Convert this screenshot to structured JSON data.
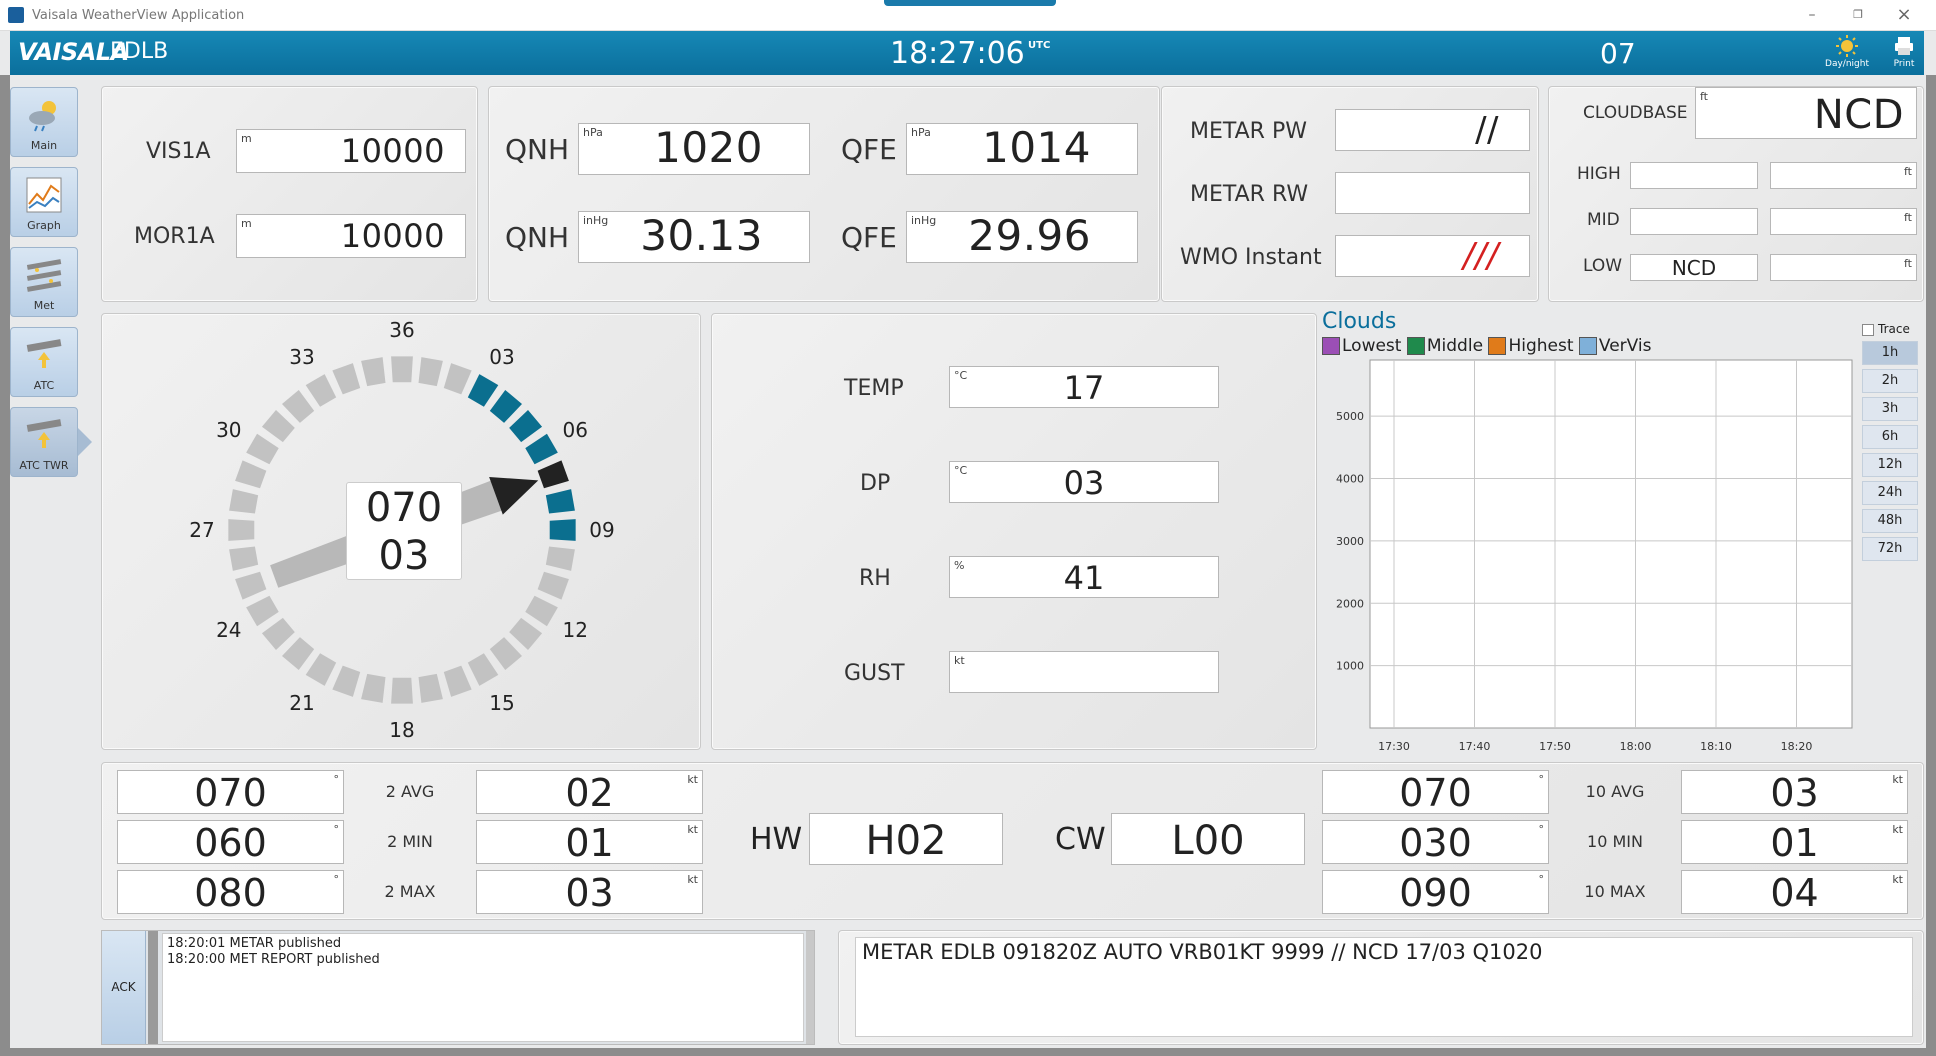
{
  "window": {
    "title": "Vaisala WeatherView Application"
  },
  "header": {
    "brand": "VAISALA",
    "station": "EDLB",
    "time": "18:27:06",
    "time_zone": "UTC",
    "code": "07",
    "daynight_label": "Day/night",
    "print_label": "Print"
  },
  "nav": [
    {
      "label": "Main",
      "icon": "cloud-sun-icon"
    },
    {
      "label": "Graph",
      "icon": "graph-icon"
    },
    {
      "label": "Met",
      "icon": "met-icon"
    },
    {
      "label": "ATC",
      "icon": "runway-icon"
    },
    {
      "label": "ATC TWR",
      "icon": "tower-runway-icon"
    }
  ],
  "visibility": {
    "vis_label": "VIS1A",
    "vis_unit": "m",
    "vis_value": "10000",
    "mor_label": "MOR1A",
    "mor_unit": "m",
    "mor_value": "10000"
  },
  "pressure": {
    "qnh_label": "QNH",
    "qfe_label": "QFE",
    "qnh_hpa": "1020",
    "qfe_hpa": "1014",
    "hpa_unit": "hPa",
    "qnh_inhg": "30.13",
    "qfe_inhg": "29.96",
    "inhg_unit": "inHg"
  },
  "weather": {
    "pw_label": "METAR PW",
    "pw_value": "//",
    "rw_label": "METAR RW",
    "rw_value": "",
    "wmo_label": "WMO Instant",
    "wmo_value": "///",
    "wmo_color": "#d42020"
  },
  "cloudbase": {
    "label": "CLOUDBASE",
    "unit": "ft",
    "value": "NCD",
    "high_label": "HIGH",
    "high_value": "",
    "mid_label": "MID",
    "mid_value": "",
    "low_label": "LOW",
    "low_value": "NCD"
  },
  "compass": {
    "direction": "070",
    "speed": "03",
    "labels": [
      "36",
      "03",
      "06",
      "09",
      "12",
      "15",
      "18",
      "21",
      "24",
      "27",
      "30",
      "33"
    ],
    "variable_from_deg": 30,
    "variable_to_deg": 90,
    "direction_deg": 70,
    "accent": "#0b6f8f",
    "segment_color": "#c2c2c2"
  },
  "thermo": {
    "temp_label": "TEMP",
    "temp_unit": "°C",
    "temp_value": "17",
    "dp_label": "DP",
    "dp_unit": "°C",
    "dp_value": "03",
    "rh_label": "RH",
    "rh_unit": "%",
    "rh_value": "41",
    "gust_label": "GUST",
    "gust_unit": "kt",
    "gust_value": ""
  },
  "clouds": {
    "title": "Clouds",
    "legend": [
      {
        "name": "Lowest",
        "color": "#9b4fb5"
      },
      {
        "name": "Middle",
        "color": "#1f8a4c"
      },
      {
        "name": "Highest",
        "color": "#e07b1a"
      },
      {
        "name": "VerVis",
        "color": "#7fb0d9"
      }
    ],
    "trace_label": "Trace",
    "ranges": [
      "1h",
      "2h",
      "3h",
      "6h",
      "12h",
      "24h",
      "48h",
      "72h"
    ],
    "selected_range": "1h"
  },
  "chart_data": {
    "type": "line",
    "title": "Clouds",
    "x": [
      "17:30",
      "17:40",
      "17:50",
      "18:00",
      "18:10",
      "18:20"
    ],
    "yticks": [
      1000,
      2000,
      3000,
      4000,
      5000
    ],
    "ylim": [
      0,
      5900
    ],
    "series": [],
    "grid": true
  },
  "wind2": {
    "dir_avg": "070",
    "dir_min": "060",
    "dir_max": "080",
    "avg_label": "2 AVG",
    "min_label": "2 MIN",
    "max_label": "2 MAX",
    "spd_avg": "02",
    "spd_min": "01",
    "spd_max": "03",
    "deg_unit": "°",
    "kt_unit": "kt"
  },
  "components": {
    "hw_label": "HW",
    "hw_value": "H02",
    "cw_label": "CW",
    "cw_value": "L00"
  },
  "wind10": {
    "dir_avg": "070",
    "dir_min": "030",
    "dir_max": "090",
    "avg_label": "10 AVG",
    "min_label": "10 MIN",
    "max_label": "10 MAX",
    "spd_avg": "03",
    "spd_min": "01",
    "spd_max": "04"
  },
  "log": {
    "ack_label": "ACK",
    "messages": [
      "18:20:01 METAR published",
      "18:20:00 MET REPORT published"
    ]
  },
  "metar": {
    "text": "METAR EDLB 091820Z AUTO VRB01KT 9999 // NCD 17/03 Q1020"
  }
}
